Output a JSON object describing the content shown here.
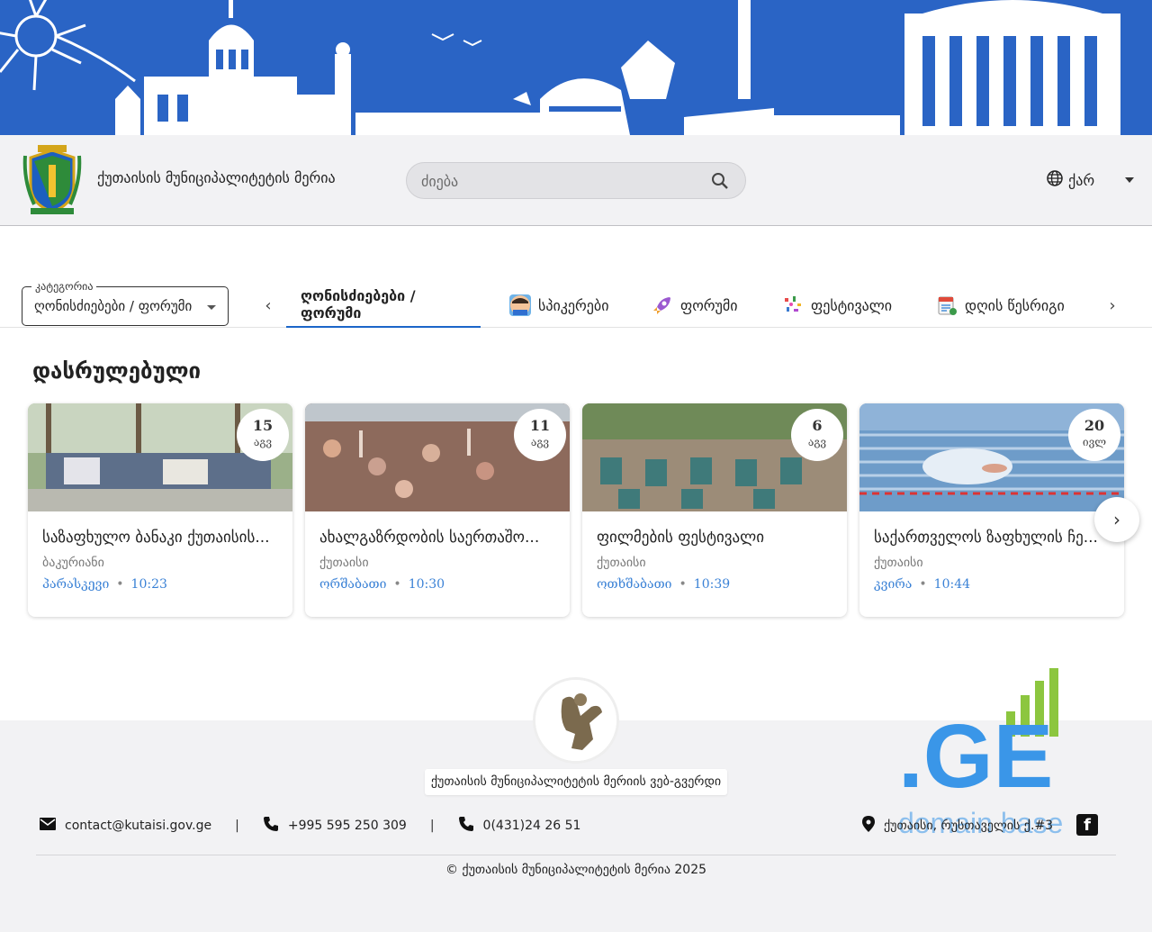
{
  "header": {
    "site_title": "ქუთაისის მუნიციპალიტეტის მერია",
    "search_placeholder": "ძიება",
    "language": "ქარ"
  },
  "category_select": {
    "label": "კატეგორია",
    "value": "ღონისძიებები / ფორუმი"
  },
  "tabs": [
    {
      "label": "ღონისძიებები / ფორუმი",
      "icon": "none",
      "active": true
    },
    {
      "label": "სპიკერები",
      "icon": "speaker-avatar-icon"
    },
    {
      "label": "ფორუმი",
      "icon": "rocket-icon"
    },
    {
      "label": "ფესტივალი",
      "icon": "confetti-icon"
    },
    {
      "label": "დღის წესრიგი",
      "icon": "agenda-icon"
    }
  ],
  "section_title": "დასრულებული",
  "events": [
    {
      "day": "15",
      "month": "აგვ",
      "title": "საზაფხულო ბანაკი ქუთაისის...",
      "place": "ბაკურიანი",
      "weekday": "პარასკევი",
      "time": "10:23"
    },
    {
      "day": "11",
      "month": "აგვ",
      "title": "ახალგაზრდობის საერთაშო...",
      "place": "ქუთაისი",
      "weekday": "ორშაბათი",
      "time": "10:30"
    },
    {
      "day": "6",
      "month": "აგვ",
      "title": "ფილმების ფესტივალი",
      "place": "ქუთაისი",
      "weekday": "ოთხშაბათი",
      "time": "10:39"
    },
    {
      "day": "20",
      "month": "ივლ",
      "title": "საქართველოს ზაფხულის ჩე...",
      "place": "ქუთაისი",
      "weekday": "კვირა",
      "time": "10:44"
    }
  ],
  "footer": {
    "site_name": "ქუთაისის მუნიციპალიტეტის მერიის ვებ-გვერდი",
    "email": "contact@kutaisi.gov.ge",
    "phone1": "+995 595 250 309",
    "phone2": "0(431)24 26 51",
    "address": "ქუთაისი, რუსთაველის ქ.#3",
    "copyright": "© ქუთაისის მუნიციპალიტეტის მერია 2025",
    "separator": "|"
  },
  "watermark": {
    "brand": ".GE",
    "text": "domain base"
  },
  "colors": {
    "banner": "#2a64c5",
    "accent": "#1b66c9",
    "link": "#3b82d6"
  }
}
